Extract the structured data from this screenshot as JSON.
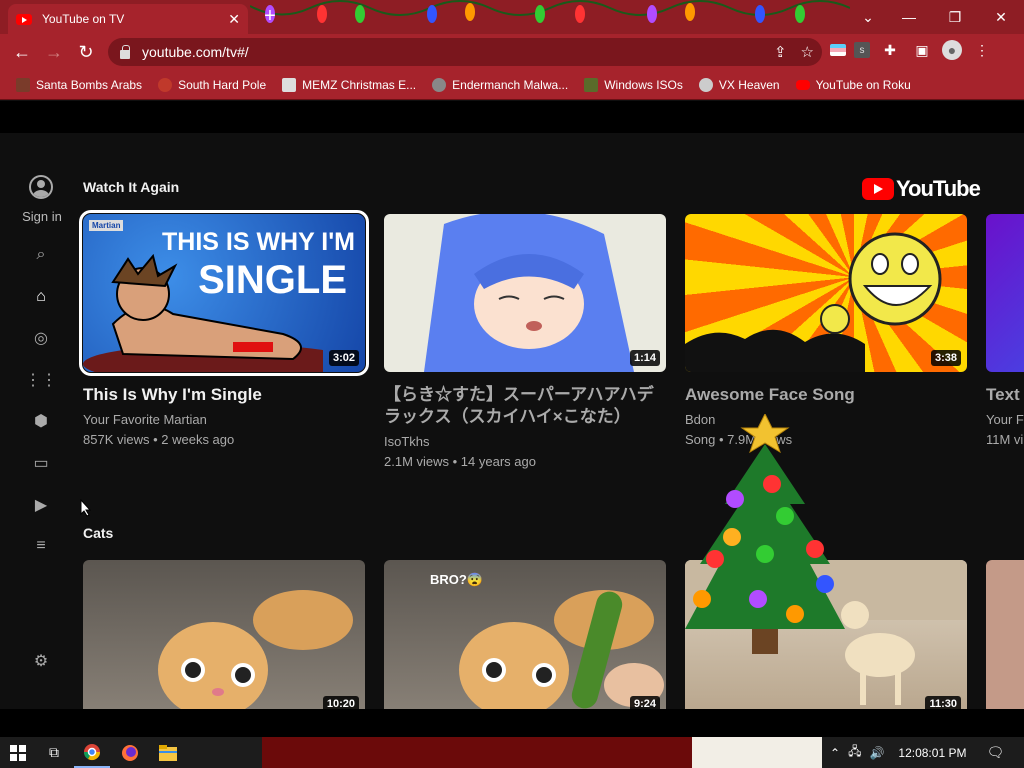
{
  "browser": {
    "tab_title": "YouTube on TV",
    "url": "youtube.com/tv#/",
    "bookmarks": [
      {
        "label": "Santa Bombs Arabs",
        "icon": "santa-icon",
        "color": "#7a3b2a"
      },
      {
        "label": "South Hard Pole",
        "icon": "snowflake-icon",
        "color": "#c0392b"
      },
      {
        "label": "MEMZ Christmas E...",
        "icon": "memz-icon",
        "color": "#dddddd"
      },
      {
        "label": "Endermanch Malwa...",
        "icon": "endermanch-icon",
        "color": "#888888"
      },
      {
        "label": "Windows ISOs",
        "icon": "folder-icon",
        "color": "#5a6b2a"
      },
      {
        "label": "VX Heaven",
        "icon": "vx-icon",
        "color": "#cccccc"
      },
      {
        "label": "YouTube on Roku",
        "icon": "youtube-icon",
        "color": "#ff0000"
      }
    ]
  },
  "sidebar": {
    "signin_label": "Sign in"
  },
  "logo": {
    "word": "YouTube"
  },
  "sections": {
    "watch_again": {
      "title": "Watch It Again",
      "videos": [
        {
          "title": "This Is Why I'm Single",
          "channel": "Your Favorite Martian",
          "meta": "857K views • 2 weeks ago",
          "duration": "3:02",
          "thumb_text_1": "THIS IS WHY I'M",
          "thumb_text_2": "SINGLE",
          "thumb_logo": "Martian"
        },
        {
          "title": "【らき☆すた】スーパーアハアハデラックス（スカイハイ×こなた）",
          "channel": "IsoTkhs",
          "meta": "2.1M views • 14 years ago",
          "duration": "1:14"
        },
        {
          "title": "Awesome Face Song",
          "channel": "Bdon",
          "meta": "Song • 7.9M views",
          "duration": "3:38"
        },
        {
          "title": "Text",
          "channel": "Your Fa",
          "meta": "11M vi"
        }
      ]
    },
    "cats": {
      "title": "Cats",
      "videos": [
        {
          "duration": "10:20"
        },
        {
          "duration": "9:24",
          "thumb_text": "BRO?😨"
        },
        {
          "duration": "11:30"
        }
      ]
    }
  },
  "taskbar": {
    "time": "12:08:01 PM"
  }
}
